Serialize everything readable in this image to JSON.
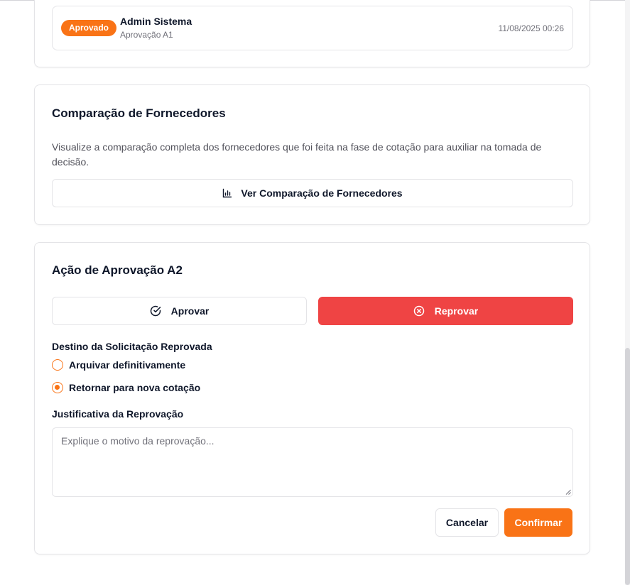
{
  "history": {
    "badge": "Aprovado",
    "name": "Admin Sistema",
    "stage": "Aprovação A1",
    "date": "11/08/2025 00:26"
  },
  "comparison": {
    "title": "Comparação de Fornecedores",
    "description": "Visualize a comparação completa dos fornecedores que foi feita na fase de cotação para auxiliar na tomada de decisão.",
    "button_label": "Ver Comparação de Fornecedores",
    "button_icon": "bar-chart-icon"
  },
  "action": {
    "title": "Ação de Aprovação A2",
    "approve_label": "Aprovar",
    "approve_icon": "check-circle-icon",
    "reject_label": "Reprovar",
    "reject_icon": "x-circle-icon",
    "destination_label": "Destino da Solicitação Reprovada",
    "options": [
      {
        "label": "Arquivar definitivamente",
        "checked": false
      },
      {
        "label": "Retornar para nova cotação",
        "checked": true
      }
    ],
    "justification_label": "Justificativa da Reprovação",
    "justification_placeholder": "Explique o motivo da reprovação...",
    "justification_value": "",
    "cancel_label": "Cancelar",
    "confirm_label": "Confirmar"
  },
  "colors": {
    "accent": "#f97316",
    "danger": "#ef4444",
    "border": "#e4e4e7",
    "muted_text": "#71717a"
  }
}
